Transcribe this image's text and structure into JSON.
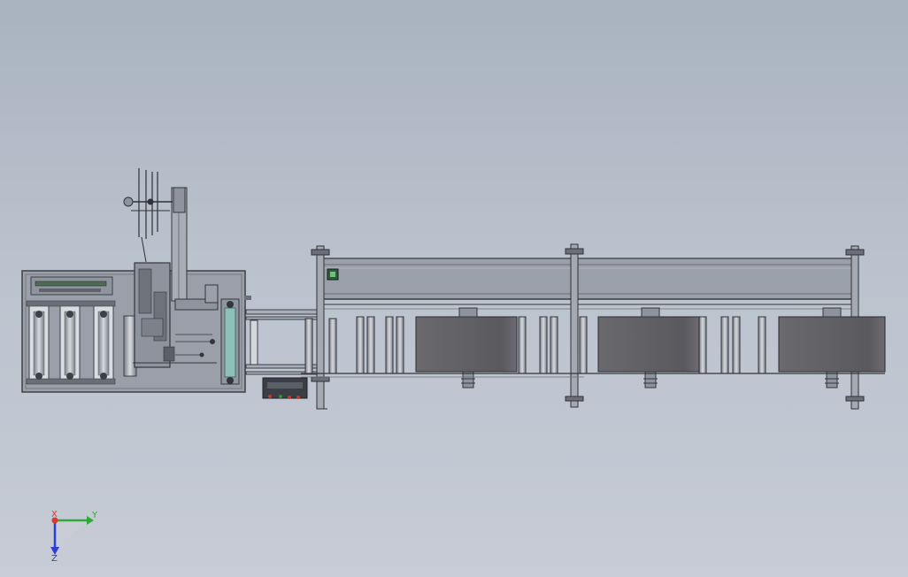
{
  "triad": {
    "x_label": "X",
    "y_label": "Y",
    "z_label": "Z",
    "x_color": "#d93a2b",
    "y_color": "#2fa83a",
    "z_color": "#2b3fd6"
  },
  "colors": {
    "background_top": "#a9b3c0",
    "background_bottom": "#c7ccd6",
    "frame": "#8d929c",
    "frame_dark": "#4a4d54",
    "roll": "#5d5d61",
    "panel": "#9da2ad"
  }
}
